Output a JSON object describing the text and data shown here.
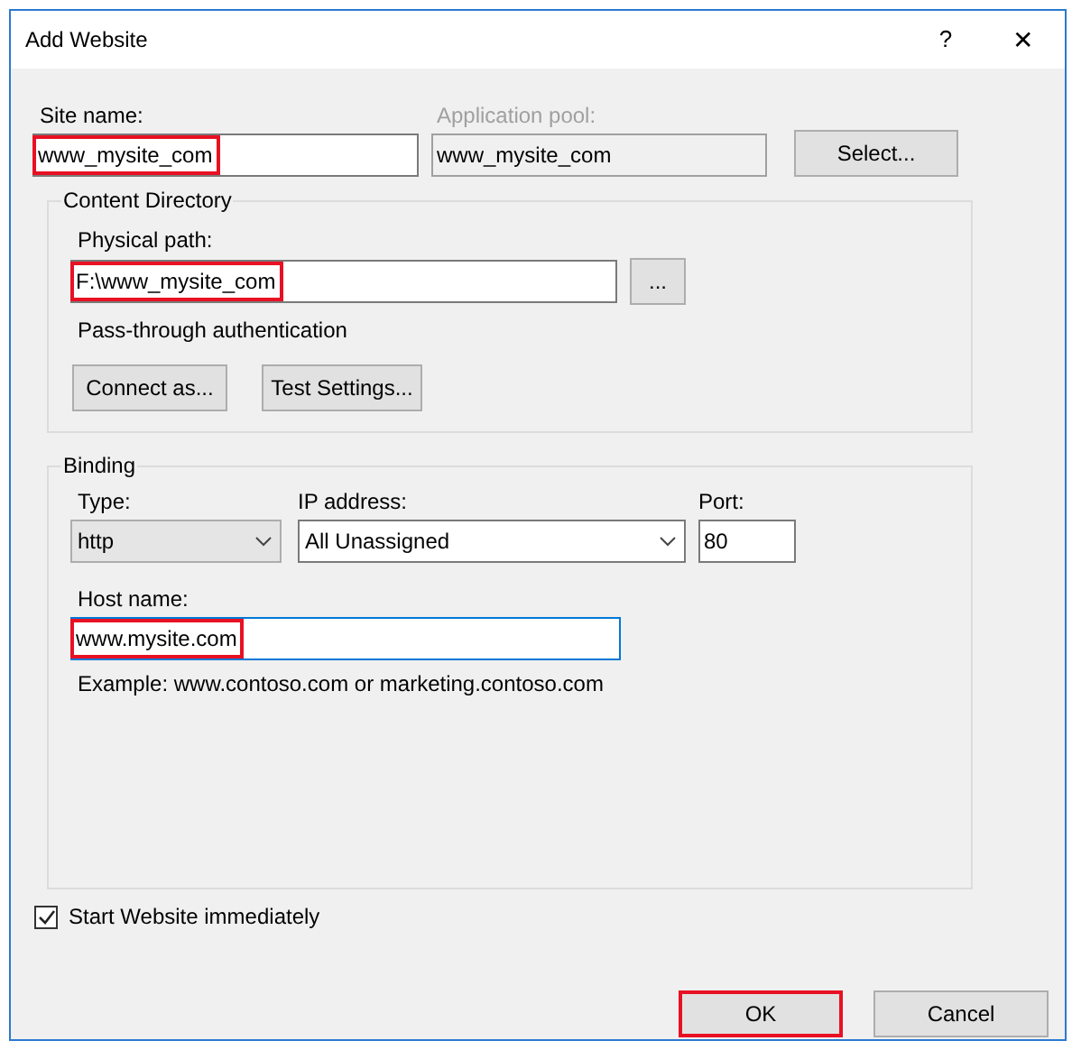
{
  "window": {
    "title": "Add Website",
    "help": "?",
    "close": "✕"
  },
  "site_name": {
    "label": "Site name:",
    "value": "www_mysite_com",
    "highlighted": true
  },
  "application_pool": {
    "label": "Application pool:",
    "value": "www_mysite_com",
    "disabled": true
  },
  "select_button": {
    "label": "Select..."
  },
  "content_directory": {
    "title": "Content Directory",
    "physical_path": {
      "label": "Physical path:",
      "value": "F:\\www_mysite_com",
      "highlighted": true
    },
    "browse_button": "...",
    "pass_through_label": "Pass-through authentication",
    "buttons": [
      "Connect as...",
      "Test Settings..."
    ]
  },
  "binding": {
    "title": "Binding",
    "type": {
      "label": "Type:",
      "value": "http"
    },
    "ip_address": {
      "label": "IP address:",
      "value": "All Unassigned"
    },
    "port": {
      "label": "Port:",
      "value": "80"
    },
    "host_name": {
      "label": "Host name:",
      "value": "www.mysite.com",
      "highlighted": true,
      "focused": true
    },
    "example": "Example: www.contoso.com or marketing.contoso.com"
  },
  "start_immediately": {
    "label": "Start Website immediately",
    "checked": true
  },
  "buttons": [
    {
      "label": "OK",
      "highlighted": true
    },
    {
      "label": "Cancel",
      "highlighted": false
    }
  ]
}
